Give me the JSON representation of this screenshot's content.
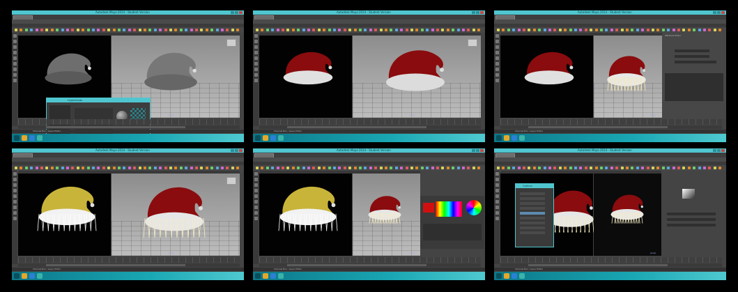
{
  "app": {
    "window_title": "Autodesk Maya 2014 - Student Version",
    "menu_items": [
      "File",
      "Edit",
      "Modify",
      "Create",
      "Display",
      "Window",
      "Assets",
      "Lighting/Shading",
      "Texturing",
      "Render",
      "Toon",
      "Stereo",
      "Paint Effects",
      "Fur",
      "Hair",
      "Help"
    ],
    "menu_set": "Rendering",
    "shelf_tabs": [
      "Curves",
      "Surfaces",
      "Polygons",
      "Subdivs",
      "Deformation",
      "Animation",
      "Dynamics",
      "Rendering",
      "PaintEffects",
      "Toon",
      "Muscle",
      "Fluids",
      "Fur",
      "Hair",
      "nCloth",
      "Custom"
    ],
    "camera_label": "persp",
    "command_line_text": "Channel Box / Layer Editor"
  },
  "panels": [
    {
      "id": "p1",
      "stage": "untextured-gray",
      "overlay": "hypershade-window",
      "overlay_title": "Hypershade"
    },
    {
      "id": "p2",
      "stage": "red-material",
      "overlay": "none"
    },
    {
      "id": "p3",
      "stage": "fur-preview",
      "overlay": "attribute-editor",
      "overlay_title": "Attribute Editor"
    },
    {
      "id": "p4",
      "stage": "yellow-fur-render",
      "overlay": "none"
    },
    {
      "id": "p5",
      "stage": "color-chooser",
      "overlay": "color-picker",
      "overlay_title": "Color Chooser",
      "picked_color": "#d01010"
    },
    {
      "id": "p6",
      "stage": "outliner",
      "overlay": "outliner",
      "overlay_title": "Outliner"
    }
  ],
  "colors": {
    "accent": "#4fc6cf",
    "taskbar": "#1aa7b4",
    "hat_red": "#8a0c0e",
    "hat_gray": "#6e6e6e",
    "fur_yellow": "#c9b43a",
    "fur_white": "#f2f2f2"
  }
}
